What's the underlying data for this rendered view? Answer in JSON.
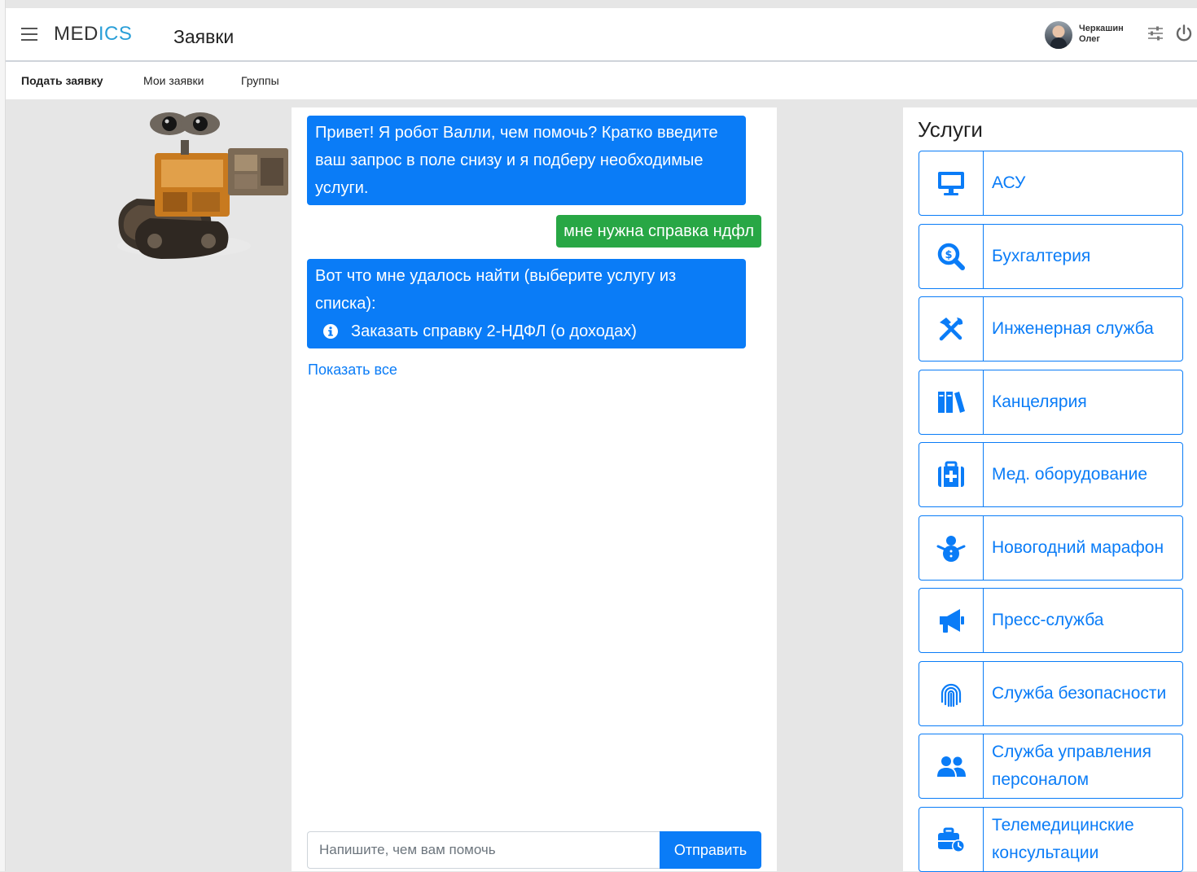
{
  "header": {
    "brand_part1": "MED",
    "brand_part2": "ICS",
    "page_title": "Заявки",
    "user_first": "Черкашин",
    "user_second": "Олег"
  },
  "subnav": {
    "items": [
      "Подать заявку",
      "Мои заявки",
      "Группы"
    ]
  },
  "chat": {
    "messages": [
      {
        "from": "bot",
        "text": "Привет! Я робот Валли, чем помочь? Кратко введите ваш запрос в поле снизу и я подберу необходимые услуги."
      },
      {
        "from": "user",
        "text": "мне нужна справка ндфл"
      },
      {
        "from": "bot",
        "text": "Вот что мне удалось найти (выберите услугу из списка):",
        "result": "Заказать справку 2-НДФЛ (о доходах)"
      }
    ],
    "show_all": "Показать все",
    "input_placeholder": "Напишите, чем вам помочь",
    "send_label": "Отправить"
  },
  "services": {
    "title": "Услуги",
    "items": [
      {
        "label": "АСУ",
        "icon": "monitor-icon"
      },
      {
        "label": "Бухгалтерия",
        "icon": "search-dollar-icon"
      },
      {
        "label": "Инженерная служба",
        "icon": "tools-icon"
      },
      {
        "label": "Канцелярия",
        "icon": "books-icon"
      },
      {
        "label": "Мед. оборудование",
        "icon": "medkit-icon"
      },
      {
        "label": "Новогодний марафон",
        "icon": "snowman-icon"
      },
      {
        "label": "Пресс-служба",
        "icon": "megaphone-icon"
      },
      {
        "label": "Служба безопасности",
        "icon": "fingerprint-icon"
      },
      {
        "label": "Служба управления персоналом",
        "icon": "users-icon"
      },
      {
        "label": "Телемедицинские консультации",
        "icon": "briefcase-clock-icon"
      }
    ]
  },
  "colors": {
    "primary": "#0a7cf7",
    "success": "#28a745",
    "brand_accent": "#2a9fd8",
    "background": "#e6e6e6"
  }
}
